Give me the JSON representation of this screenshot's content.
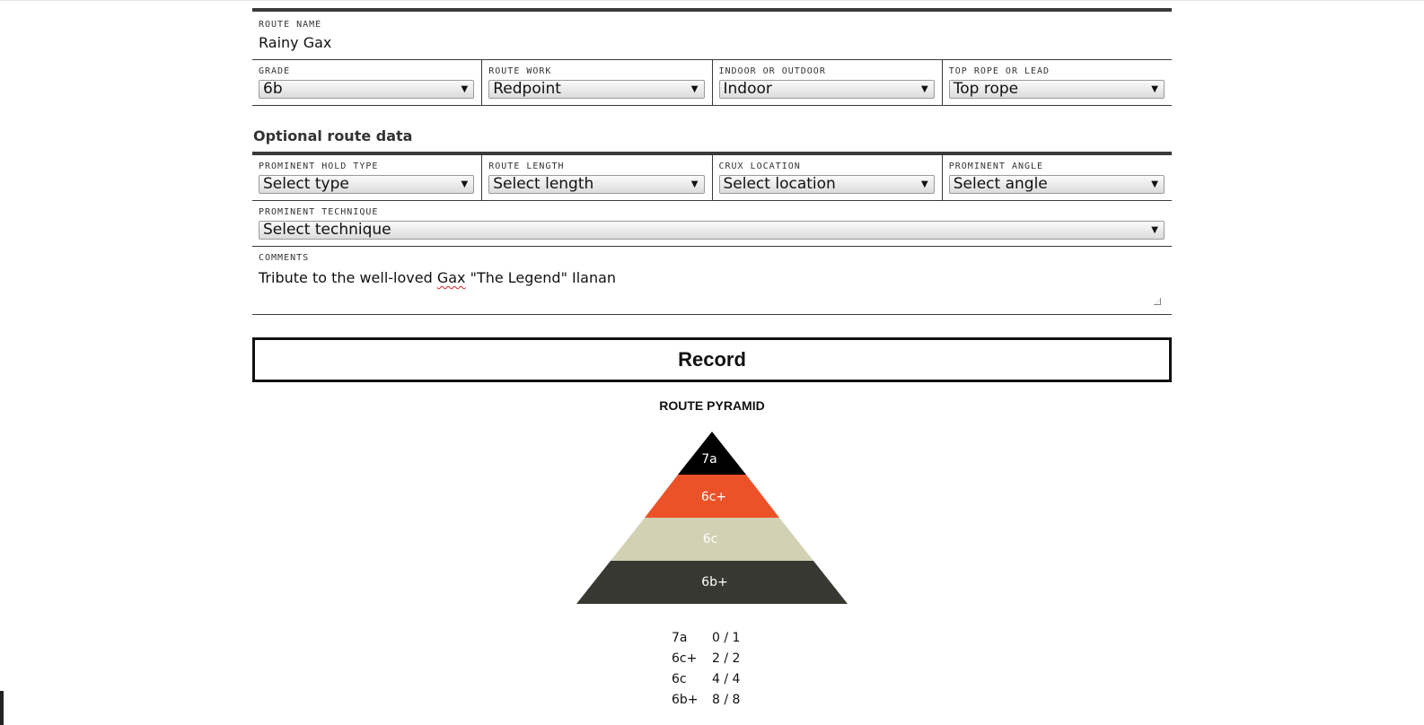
{
  "route": {
    "name_label": "ROUTE NAME",
    "name_value_parts": [
      "Rainy Gax"
    ],
    "fields": [
      {
        "label": "GRADE",
        "value": "6b"
      },
      {
        "label": "ROUTE WORK",
        "value": "Redpoint"
      },
      {
        "label": "INDOOR OR OUTDOOR",
        "value": "Indoor"
      },
      {
        "label": "TOP ROPE OR LEAD",
        "value": "Top rope"
      }
    ]
  },
  "optional": {
    "title": "Optional route data",
    "fields": [
      {
        "label": "PROMINENT HOLD TYPE",
        "value": "Select type"
      },
      {
        "label": "ROUTE LENGTH",
        "value": "Select length"
      },
      {
        "label": "CRUX LOCATION",
        "value": "Select location"
      },
      {
        "label": "PROMINENT ANGLE",
        "value": "Select angle"
      }
    ],
    "technique": {
      "label": "PROMINENT TECHNIQUE",
      "value": "Select technique"
    },
    "comments": {
      "label": "COMMENTS",
      "before": "Tribute to the well-loved ",
      "misspelled": "Gax",
      "after": " \"The Legend\" Ilanan"
    }
  },
  "record_label": "Record",
  "pyramid": {
    "title": "ROUTE PYRAMID",
    "levels": [
      {
        "grade": "7a",
        "color": "#000000",
        "text_color": "#ffffff"
      },
      {
        "grade": "6c+",
        "color": "#ec5228",
        "text_color": "#ffffff"
      },
      {
        "grade": "6c",
        "color": "#d2d1b3",
        "text_color": "#ffffff"
      },
      {
        "grade": "6b+",
        "color": "#383833",
        "text_color": "#ffffff"
      }
    ],
    "table": [
      {
        "grade": "7a",
        "count": "0 / 1"
      },
      {
        "grade": "6c+",
        "count": "2 / 2"
      },
      {
        "grade": "6c",
        "count": "4 / 4"
      },
      {
        "grade": "6b+",
        "count": "8 / 8"
      }
    ]
  },
  "icons": {
    "dropdown_arrow": "▼"
  }
}
